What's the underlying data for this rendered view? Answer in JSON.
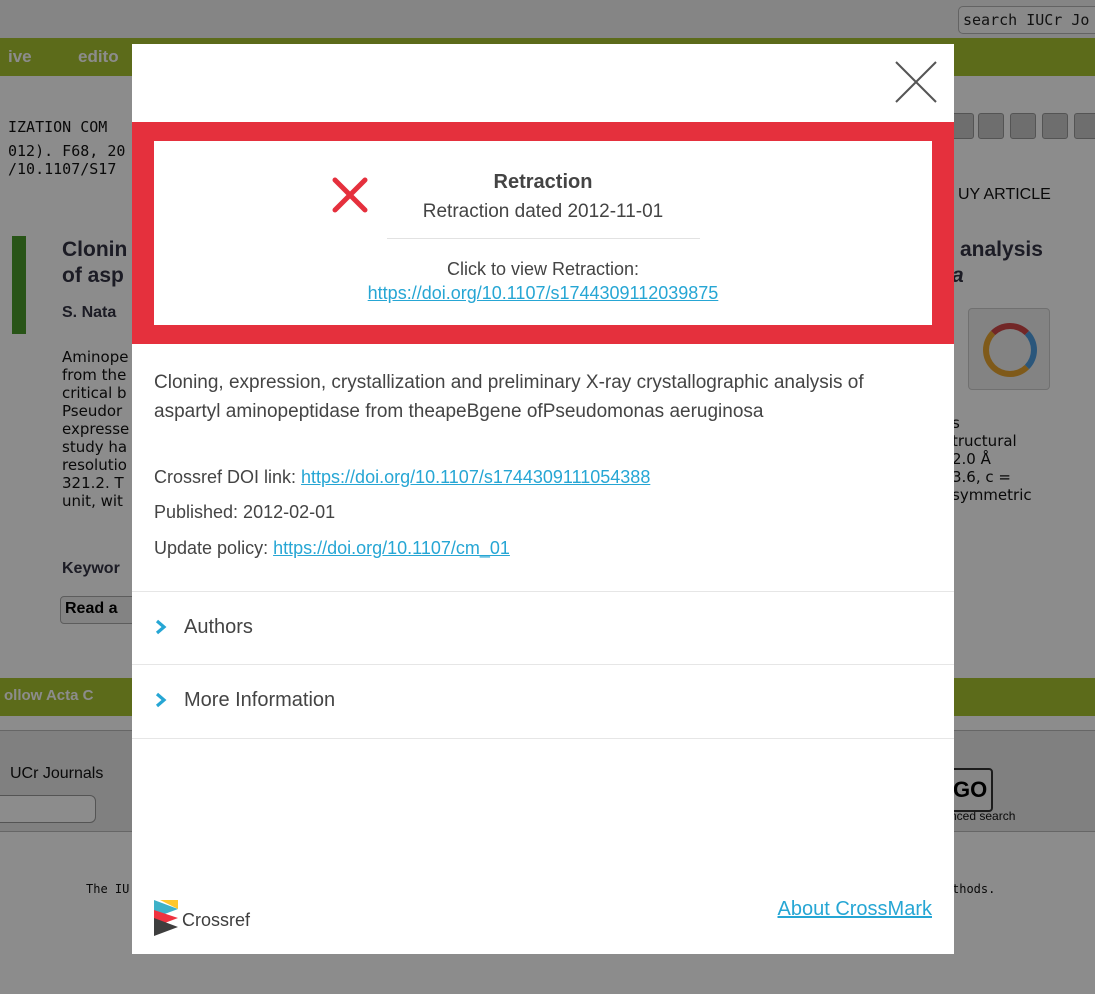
{
  "background": {
    "search_label": "search IUCr Jo",
    "nav": [
      "ive",
      "edito"
    ],
    "lines": [
      "IZATION COM",
      "012). F68, 20",
      "/10.1107/S17"
    ],
    "title_left": [
      "Clonin",
      "of asp"
    ],
    "title_right": [
      "analysis",
      "a"
    ],
    "authors": "S. Nata",
    "abstract_left": "Aminope\nfrom the\ncritical b\nPseudor\nexpresse\nstudy ha\nresolutio\n321.2. T\nunit, wit",
    "abstract_right": "s\ntructural\n2.0 Å\n3.6, c =\nsymmetric",
    "keywords": "Keywor",
    "read": "Read a",
    "buy": "UY ARTICLE",
    "follow": "ollow Acta C",
    "journals": "UCr Journals",
    "go": "GO",
    "advanced": "nced search",
    "footer_left": "The IU",
    "footer_right": "thods."
  },
  "modal": {
    "retraction": {
      "heading": "Retraction",
      "dated": "Retraction dated 2012-11-01",
      "click_label": "Click to view Retraction:",
      "link": "https://doi.org/10.1107/s1744309112039875",
      "status_color": "#e5303d"
    },
    "article_title": "Cloning, expression, crystallization and preliminary X-ray crystallographic analysis of aspartyl aminopeptidase from theapeBgene ofPseudomonas aeruginosa",
    "doi_label": "Crossref DOI link: ",
    "doi_link": "https://doi.org/10.1107/s1744309111054388",
    "published": "Published: 2012-02-01",
    "policy_label": "Update policy: ",
    "policy_link": "https://doi.org/10.1107/cm_01",
    "sections": [
      "Authors",
      "More Information"
    ],
    "brand": "Crossref",
    "about_link": "About CrossMark",
    "accent_color": "#26a6d4"
  }
}
